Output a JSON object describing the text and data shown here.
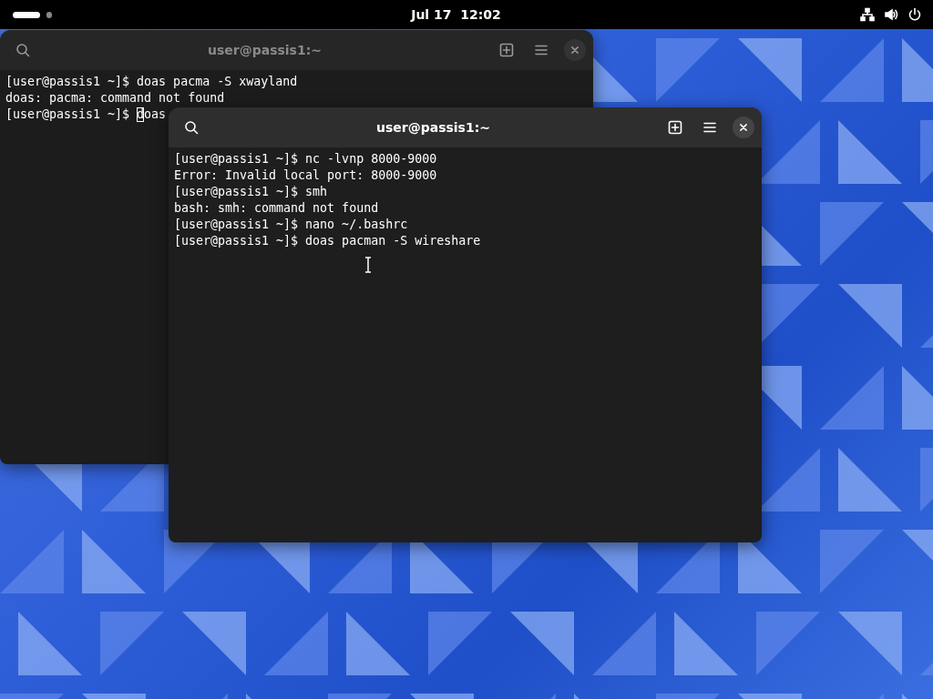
{
  "top_bar": {
    "clock": "Jul 17  12:02",
    "workspaces": [
      {
        "selected": true
      },
      {
        "selected": false
      }
    ]
  },
  "windows": [
    {
      "title": "user@passis1:~",
      "focused": false,
      "lines": [
        "[user@passis1 ~]$ doas pacma -S xwayland",
        "doas: pacma: command not found",
        "[user@passis1 ~]$ doas"
      ]
    },
    {
      "title": "user@passis1:~",
      "focused": true,
      "lines": [
        "[user@passis1 ~]$ nc -lvnp 8000-9000",
        "Error: Invalid local port: 8000-9000",
        "[user@passis1 ~]$ smh",
        "bash: smh: command not found",
        "[user@passis1 ~]$ nano ~/.bashrc",
        "[user@passis1 ~]$ doas pacman -S wireshare"
      ]
    }
  ]
}
